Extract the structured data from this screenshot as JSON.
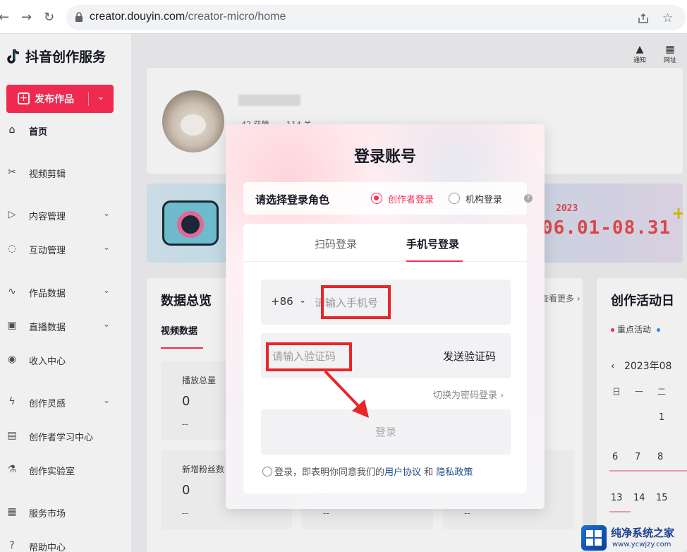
{
  "browser": {
    "back": "←",
    "forward": "→",
    "reload": "↻",
    "url_domain": "creator.douyin.com",
    "url_path": "/creator-micro/home",
    "share_icon": "share-icon",
    "star_icon": "☆"
  },
  "sidebar": {
    "logo_text": "抖音创作服务",
    "publish_label": "发布作品",
    "items": [
      {
        "label": "首页",
        "icon": "home-icon",
        "glyph": "⌂",
        "chevron": false
      },
      {
        "label": "视频剪辑",
        "icon": "scissors-icon",
        "glyph": "✂",
        "chevron": false
      },
      {
        "label": "内容管理",
        "icon": "content-icon",
        "glyph": "▷",
        "chevron": true
      },
      {
        "label": "互动管理",
        "icon": "chat-icon",
        "glyph": "◌",
        "chevron": true
      },
      {
        "label": "作品数据",
        "icon": "chart-icon",
        "glyph": "∿",
        "chevron": true
      },
      {
        "label": "直播数据",
        "icon": "live-icon",
        "glyph": "▣",
        "chevron": true
      },
      {
        "label": "收入中心",
        "icon": "income-icon",
        "glyph": "◉",
        "chevron": false
      },
      {
        "label": "创作灵感",
        "icon": "bolt-icon",
        "glyph": "ϟ",
        "chevron": true
      },
      {
        "label": "创作者学习中心",
        "icon": "book-icon",
        "glyph": "▤",
        "chevron": false
      },
      {
        "label": "创作实验室",
        "icon": "flask-icon",
        "glyph": "⚗",
        "chevron": false
      },
      {
        "label": "服务市场",
        "icon": "market-icon",
        "glyph": "▦",
        "chevron": false
      },
      {
        "label": "帮助中心",
        "icon": "help-icon",
        "glyph": "?",
        "chevron": false
      }
    ]
  },
  "header": {
    "notify_label": "通知",
    "site_label": "网址"
  },
  "profile": {
    "stat1": "42 获赞",
    "stat2": "114 关"
  },
  "banner": {
    "year": "2023",
    "dates": "06.01-08.31",
    "plus": "+"
  },
  "data_overview": {
    "title": "数据总览",
    "more": "查看更多 ›",
    "tab": "视频数据",
    "cards": [
      {
        "label": "播放总量",
        "value": "0",
        "delta": "--"
      },
      {
        "label": "新增粉丝数",
        "value": "0",
        "delta": "--"
      }
    ],
    "extra_dash": "--"
  },
  "activity": {
    "title": "创作活动日",
    "legend": "重点活动",
    "month": "2023年08",
    "prev": "‹",
    "weekdays": [
      "日",
      "一",
      "二"
    ],
    "days": [
      "1",
      "6",
      "7",
      "8",
      "13",
      "14",
      "15"
    ]
  },
  "modal": {
    "title": "登录账号",
    "role_label": "请选择登录角色",
    "role_creator": "创作者登录",
    "role_org": "机构登录",
    "role_help": "?",
    "tab_qr": "扫码登录",
    "tab_phone": "手机号登录",
    "country_code": "+86",
    "phone_placeholder": "请输入手机号",
    "code_placeholder": "请输入验证码",
    "send_code": "发送验证码",
    "switch_password": "切换为密码登录 ›",
    "login_button": "登录",
    "agree_prefix": "登录，即表明你同意我们的",
    "agree_terms": "用户协议",
    "agree_and": "和",
    "agree_privacy": "隐私政策"
  },
  "colors": {
    "accent": "#fe2c55",
    "annotation_red": "#e8262a",
    "link_blue": "#1d4a8c"
  },
  "watermark": {
    "title": "纯净系统之家",
    "url": "www.ycwjzy.com"
  }
}
